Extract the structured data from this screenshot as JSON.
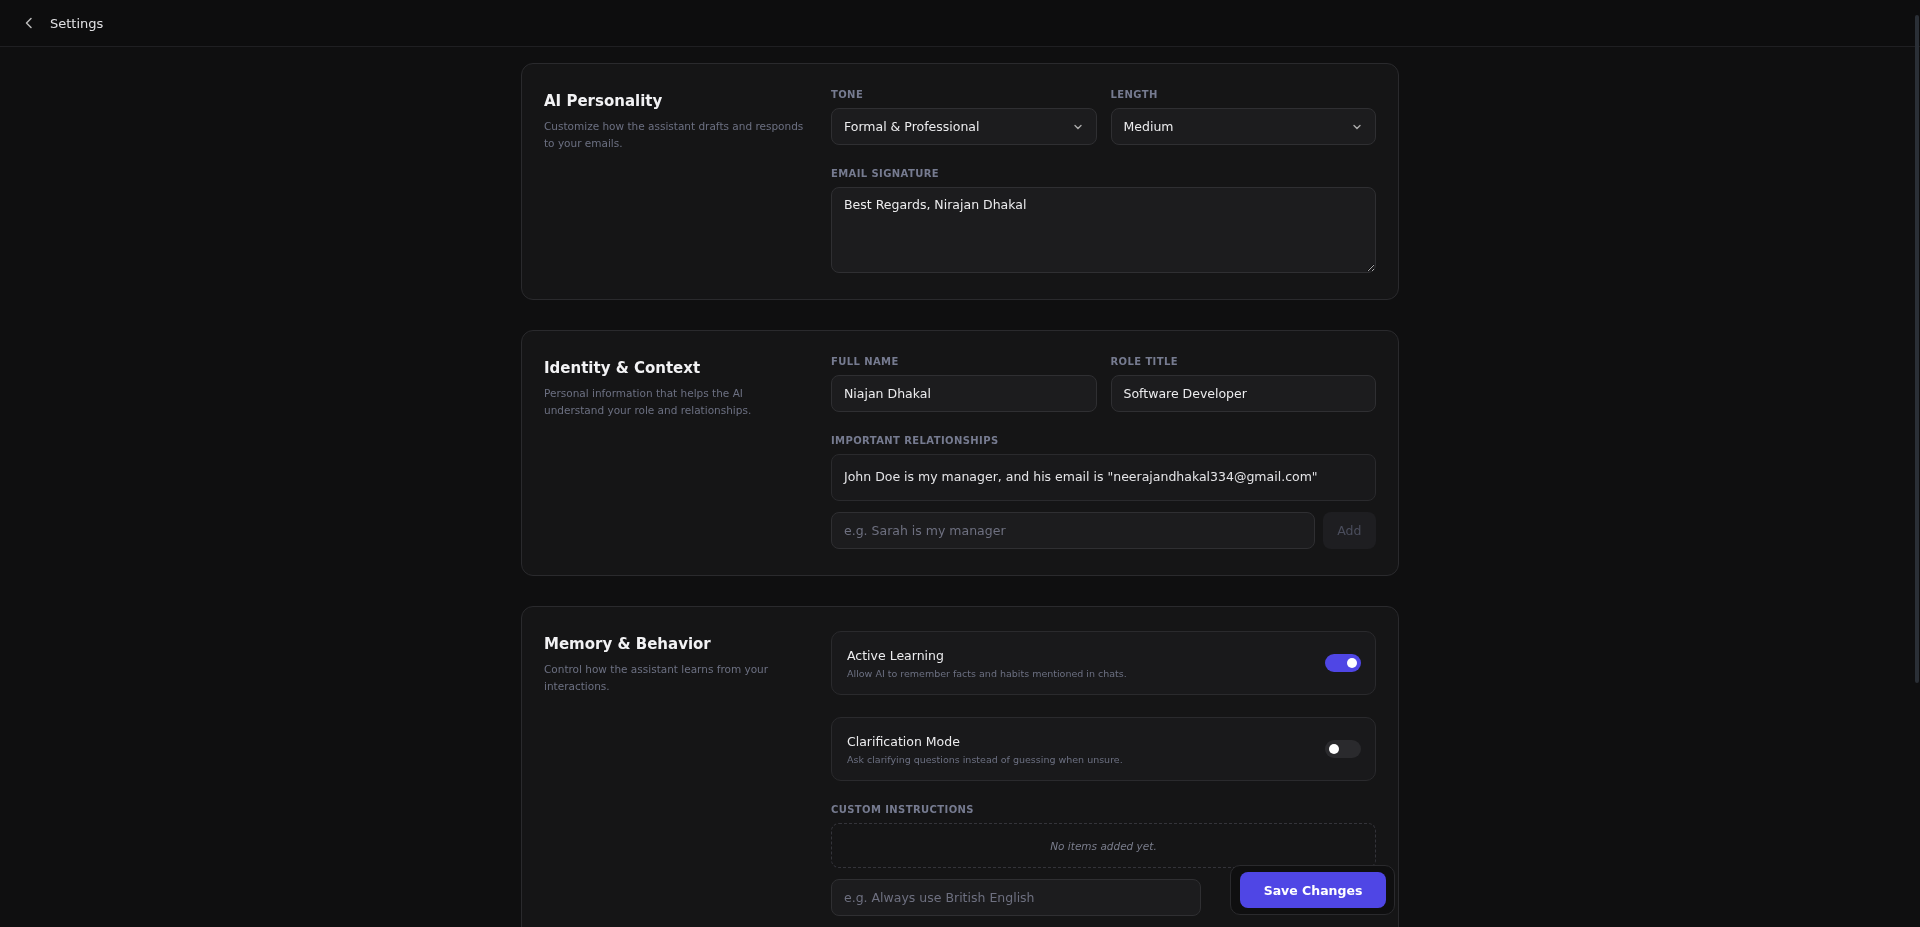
{
  "header": {
    "title": "Settings"
  },
  "sections": [
    {
      "title": "AI Personality",
      "description": "Customize how the assistant drafts and responds to your emails.",
      "rows": [
        [
          {
            "kind": "select",
            "label": "TONE",
            "value": "Formal & Professional"
          },
          {
            "kind": "select",
            "label": "LENGTH",
            "value": "Medium"
          }
        ],
        [
          {
            "kind": "textarea",
            "label": "EMAIL SIGNATURE",
            "value": "Best Regards, Nirajan Dhakal"
          }
        ]
      ]
    },
    {
      "title": "Identity & Context",
      "description": "Personal information that helps the AI understand your role and relationships.",
      "rows": [
        [
          {
            "kind": "text",
            "label": "FULL NAME",
            "value": "Niajan Dhakal"
          },
          {
            "kind": "text",
            "label": "ROLE TITLE",
            "value": "Software Developer"
          }
        ],
        [
          {
            "kind": "list",
            "label": "IMPORTANT RELATIONSHIPS",
            "items": [
              "John Doe is my manager, and his email is \"neerajandhakal334@gmail.com\""
            ],
            "placeholder": "e.g. Sarah is my manager",
            "add_button": {
              "label": "Add",
              "disabled": true
            }
          }
        ]
      ]
    },
    {
      "title": "Memory & Behavior",
      "description": "Control how the assistant learns from your interactions.",
      "rows": [
        [
          {
            "kind": "toggle",
            "title": "Active Learning",
            "description": "Allow AI to remember facts and habits mentioned in chats.",
            "on": true
          }
        ],
        [
          {
            "kind": "toggle",
            "title": "Clarification Mode",
            "description": "Ask clarifying questions instead of guessing when unsure.",
            "on": false
          }
        ],
        [
          {
            "kind": "list",
            "label": "CUSTOM INSTRUCTIONS",
            "empty_text": "No items added yet.",
            "placeholder": "e.g. Always use British English"
          }
        ]
      ]
    }
  ],
  "save_button": {
    "label": "Save Changes"
  }
}
